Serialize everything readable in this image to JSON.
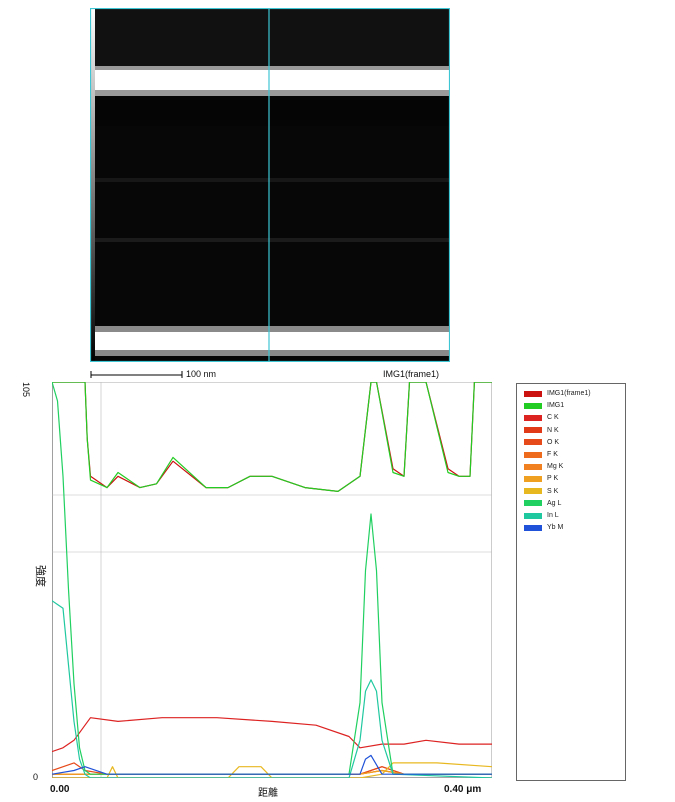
{
  "image": {
    "scale_label": "100 nm",
    "frame_label": "IMG1(frame1)"
  },
  "chart_data": {
    "type": "line",
    "ylabel": "強度",
    "xlabel": "距離",
    "x_tick_start": "0.00",
    "x_tick_end": "0.40 μm",
    "y_tick_top": "105",
    "y_tick_bottom": "0",
    "xlim": [
      0.0,
      0.4
    ],
    "ylim": [
      0,
      105
    ],
    "legend_position": "right",
    "series": [
      {
        "name": "IMG1(frame1)",
        "color": "#cc1111",
        "x": [
          0,
          0.03,
          0.032,
          0.035,
          0.05,
          0.06,
          0.08,
          0.095,
          0.11,
          0.14,
          0.16,
          0.18,
          0.2,
          0.23,
          0.26,
          0.28,
          0.29,
          0.295,
          0.31,
          0.32,
          0.325,
          0.34,
          0.36,
          0.37,
          0.38,
          0.384,
          0.4
        ],
        "y": [
          105,
          105,
          90,
          80,
          77,
          80,
          77,
          78,
          84,
          77,
          77,
          80,
          80,
          77,
          76,
          80,
          105,
          105,
          82,
          80,
          105,
          105,
          82,
          80,
          80,
          105,
          105
        ]
      },
      {
        "name": "IMG1",
        "color": "#22cc22",
        "x": [
          0,
          0.03,
          0.032,
          0.035,
          0.05,
          0.06,
          0.08,
          0.095,
          0.11,
          0.14,
          0.16,
          0.18,
          0.2,
          0.23,
          0.26,
          0.28,
          0.29,
          0.295,
          0.31,
          0.32,
          0.325,
          0.34,
          0.36,
          0.37,
          0.38,
          0.384,
          0.4
        ],
        "y": [
          105,
          105,
          90,
          79,
          77,
          81,
          77,
          78,
          85,
          77,
          77,
          80,
          80,
          77,
          76,
          80,
          105,
          105,
          81,
          80,
          105,
          105,
          81,
          80,
          80,
          105,
          105
        ]
      },
      {
        "name": "C K",
        "color": "#dd2222",
        "x": [
          0,
          0.01,
          0.02,
          0.03,
          0.035,
          0.06,
          0.1,
          0.15,
          0.2,
          0.24,
          0.27,
          0.28,
          0.3,
          0.32,
          0.34,
          0.37,
          0.4
        ],
        "y": [
          7,
          8,
          10,
          14,
          16,
          15,
          16,
          16,
          15,
          14,
          11,
          8,
          9,
          9,
          10,
          9,
          9
        ]
      },
      {
        "name": "N K",
        "color": "#e03a18",
        "x": [
          0,
          0.05,
          0.1,
          0.2,
          0.28,
          0.3,
          0.32,
          0.4
        ],
        "y": [
          1,
          1,
          1,
          1,
          1,
          3,
          1,
          1
        ]
      },
      {
        "name": "O K",
        "color": "#e64a1a",
        "x": [
          0,
          0.02,
          0.03,
          0.05,
          0.2,
          0.28,
          0.3,
          0.32,
          0.4
        ],
        "y": [
          2,
          4,
          2,
          1,
          1,
          1,
          3,
          1,
          1
        ]
      },
      {
        "name": "F K",
        "color": "#ee6b1d",
        "x": [
          0,
          0.05,
          0.1,
          0.2,
          0.28,
          0.3,
          0.32,
          0.4
        ],
        "y": [
          1,
          1,
          1,
          1,
          1,
          2,
          1,
          1
        ]
      },
      {
        "name": "Mg K",
        "color": "#f08020",
        "x": [
          0,
          0.05,
          0.1,
          0.2,
          0.28,
          0.3,
          0.32,
          0.4
        ],
        "y": [
          1,
          1,
          1,
          1,
          1,
          2,
          1,
          1
        ]
      },
      {
        "name": "P K",
        "color": "#f0a020",
        "x": [
          0,
          0.05,
          0.1,
          0.2,
          0.28,
          0.3,
          0.32,
          0.4
        ],
        "y": [
          1,
          1,
          1,
          1,
          1,
          2,
          1,
          1
        ]
      },
      {
        "name": "S K",
        "color": "#e8b820",
        "x": [
          0,
          0.05,
          0.055,
          0.06,
          0.1,
          0.16,
          0.17,
          0.19,
          0.2,
          0.22,
          0.28,
          0.3,
          0.31,
          0.33,
          0.35,
          0.4
        ],
        "y": [
          0,
          0,
          3,
          0,
          0,
          0,
          3,
          3,
          0,
          0,
          0,
          1,
          4,
          4,
          4,
          3
        ]
      },
      {
        "name": "Ag L",
        "color": "#20d060",
        "x": [
          0,
          0.005,
          0.01,
          0.015,
          0.02,
          0.025,
          0.03,
          0.035,
          0.05,
          0.1,
          0.2,
          0.27,
          0.28,
          0.285,
          0.29,
          0.295,
          0.3,
          0.31,
          0.4
        ],
        "y": [
          105,
          100,
          80,
          50,
          25,
          8,
          2,
          1,
          1,
          1,
          1,
          1,
          20,
          55,
          70,
          55,
          20,
          1,
          1
        ]
      },
      {
        "name": "In L",
        "color": "#20c8a0",
        "x": [
          0,
          0.005,
          0.01,
          0.015,
          0.02,
          0.025,
          0.03,
          0.035,
          0.05,
          0.1,
          0.2,
          0.27,
          0.28,
          0.285,
          0.29,
          0.295,
          0.3,
          0.31,
          0.4
        ],
        "y": [
          47,
          46,
          45,
          30,
          15,
          5,
          1,
          0,
          0,
          0,
          0,
          0,
          10,
          23,
          26,
          23,
          10,
          1,
          0
        ]
      },
      {
        "name": "Yb M",
        "color": "#1f52d8",
        "x": [
          0,
          0.02,
          0.03,
          0.05,
          0.2,
          0.28,
          0.285,
          0.29,
          0.3,
          0.4
        ],
        "y": [
          1,
          2,
          3,
          1,
          1,
          1,
          5,
          6,
          1,
          1
        ]
      }
    ]
  }
}
